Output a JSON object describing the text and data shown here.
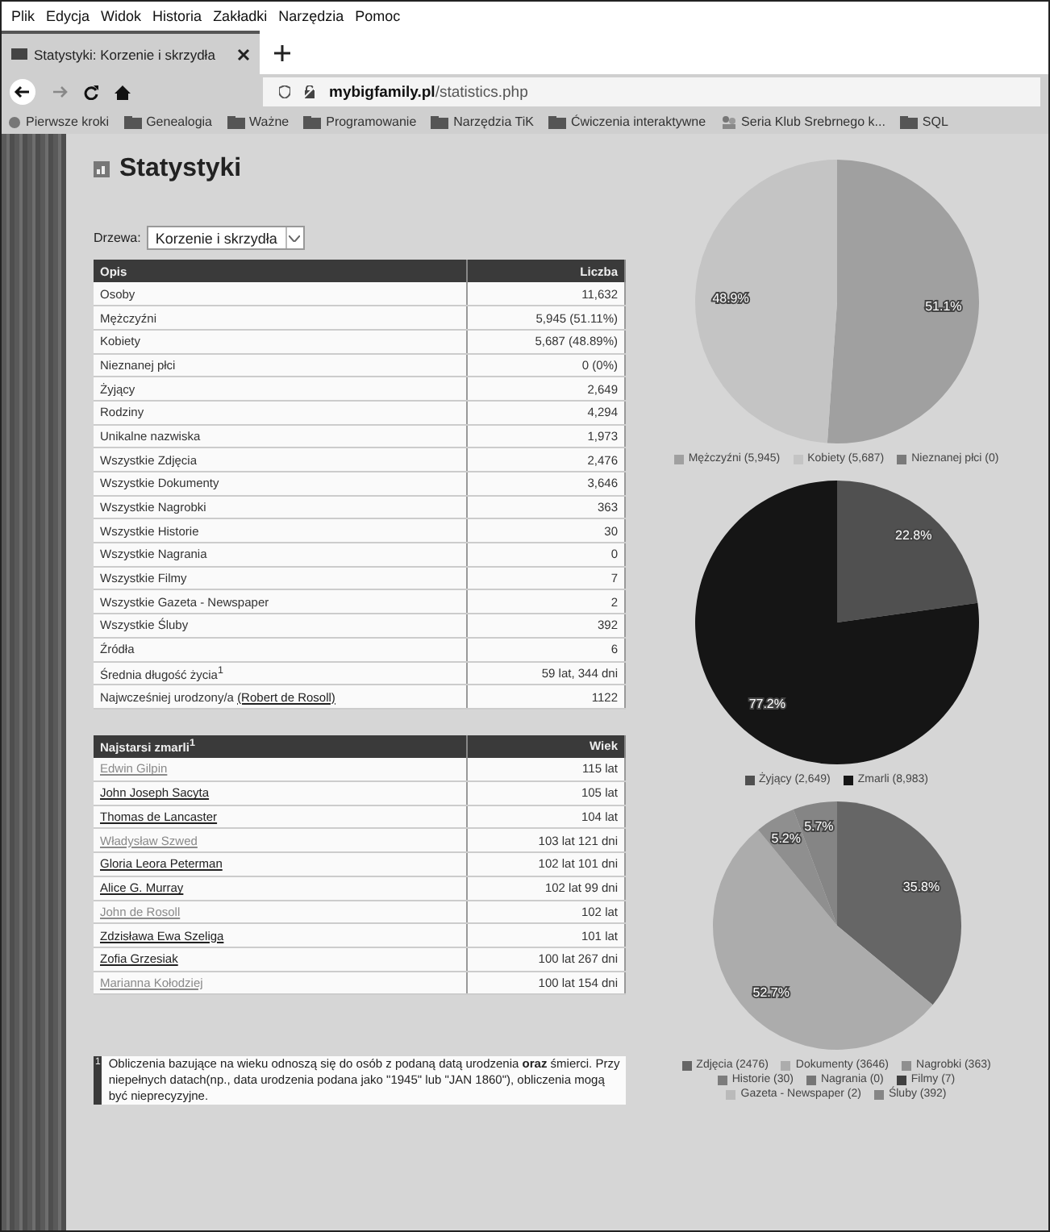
{
  "menu": [
    "Plik",
    "Edycja",
    "Widok",
    "Historia",
    "Zakładki",
    "Narzędzia",
    "Pomoc"
  ],
  "tab": {
    "title": "Statystyki: Korzenie i skrzydła",
    "selected": true
  },
  "address": {
    "domain": "mybigfamily.pl",
    "path": "/statistics.php"
  },
  "bookmarks": [
    {
      "kind": "globe",
      "label": "Pierwsze kroki"
    },
    {
      "kind": "folder",
      "label": "Genealogia"
    },
    {
      "kind": "folder",
      "label": "Ważne"
    },
    {
      "kind": "folder",
      "label": "Programowanie"
    },
    {
      "kind": "folder",
      "label": "Narzędzia TiK"
    },
    {
      "kind": "folder",
      "label": "Ćwiczenia interaktywne"
    },
    {
      "kind": "site",
      "label": "Seria Klub Srebrnego k..."
    },
    {
      "kind": "folder",
      "label": "SQL"
    }
  ],
  "page": {
    "title": "Statystyki",
    "tree_label": "Drzewa:",
    "tree_value": "Korzenie i skrzydła"
  },
  "stats_table": {
    "columns": [
      "Opis",
      "Liczba"
    ],
    "rows": [
      {
        "label": "Osoby",
        "value": "11,632"
      },
      {
        "label": "Mężczyźni",
        "value": "5,945 (51.11%)"
      },
      {
        "label": "Kobiety",
        "value": "5,687 (48.89%)"
      },
      {
        "label": "Nieznanej płci",
        "value": "0 (0%)"
      },
      {
        "label": "Żyjący",
        "value": "2,649"
      },
      {
        "label": "Rodziny",
        "value": "4,294"
      },
      {
        "label": "Unikalne nazwiska",
        "value": "1,973"
      },
      {
        "label": "Wszystkie Zdjęcia",
        "value": "2,476"
      },
      {
        "label": "Wszystkie Dokumenty",
        "value": "3,646"
      },
      {
        "label": "Wszystkie Nagrobki",
        "value": "363"
      },
      {
        "label": "Wszystkie Historie",
        "value": "30"
      },
      {
        "label": "Wszystkie Nagrania",
        "value": "0"
      },
      {
        "label": "Wszystkie Filmy",
        "value": "7"
      },
      {
        "label": "Wszystkie Gazeta - Newspaper",
        "value": "2"
      },
      {
        "label": "Wszystkie Śluby",
        "value": "392"
      },
      {
        "label": "Źródła",
        "value": "6"
      },
      {
        "label": "Średnia długość życia$^{1}$",
        "value": "59 lat, 344 dni"
      },
      {
        "label": "Najwcześniej urodzony/a",
        "link": "(Robert de Rosoll)",
        "value": "1122"
      }
    ]
  },
  "oldest_table": {
    "columns": [
      "Najstarsi zmarli$^{1}$",
      "Wiek"
    ],
    "rows": [
      {
        "name": "Edwin Gilpin",
        "visited": true,
        "age": "115 lat"
      },
      {
        "name": "John Joseph Sacyta",
        "visited": false,
        "age": "105 lat"
      },
      {
        "name": "Thomas de Lancaster",
        "visited": false,
        "age": "104 lat"
      },
      {
        "name": "Władysław Szwed",
        "visited": true,
        "age": "103 lat 121 dni"
      },
      {
        "name": "Gloria Leora Peterman",
        "visited": false,
        "age": "102 lat 101 dni"
      },
      {
        "name": "Alice G. Murray",
        "visited": false,
        "age": "102 lat 99 dni"
      },
      {
        "name": "John de Rosoll",
        "visited": true,
        "age": "102 lat"
      },
      {
        "name": "Zdzisława Ewa Szeliga",
        "visited": false,
        "age": "101 lat"
      },
      {
        "name": "Zofia Grzesiak",
        "visited": false,
        "age": "100 lat 267 dni"
      },
      {
        "name": "Marianna Kołodziej",
        "visited": true,
        "age": "100 lat 154 dni"
      }
    ]
  },
  "footnote": {
    "mark": "1",
    "text": "Obliczenia bazujące na wieku odnoszą się do osób z podaną datą urodzenia **oraz** śmierci. Przy niepełnych datach(np., data urodzenia podana jako \"1945\" lub \"JAN 1860\"), obliczenia mogą być nieprecyzyjne."
  },
  "charts": [
    {
      "chart_data": {
        "type": "pie",
        "legend": "bottom",
        "categories": [
          "Mężczyźni (5,945)",
          "Kobiety (5,687)",
          "Nieznanej płci (0)"
        ],
        "values": [
          51.1,
          48.9,
          0
        ],
        "colors": [
          "#a0a0a0",
          "#c4c4c4",
          "#7a7a7a"
        ],
        "value_labels": [
          "51.1%",
          "48.9%",
          null
        ]
      }
    },
    {
      "chart_data": {
        "type": "pie",
        "legend": "bottom",
        "categories": [
          "Żyjący (2,649)",
          "Zmarli (8,983)"
        ],
        "values": [
          22.8,
          77.2
        ],
        "colors": [
          "#505050",
          "#151515"
        ],
        "value_labels": [
          "22.8%",
          "77.2%"
        ]
      }
    },
    {
      "chart_data": {
        "type": "pie",
        "legend": "bottom",
        "categories": [
          "Zdjęcia (2476)",
          "Dokumenty (3646)",
          "Nagrobki (363)",
          "Historie (30)",
          "Nagrania (0)",
          "Filmy (7)",
          "Gazeta - Newspaper (2)",
          "Śluby (392)"
        ],
        "values": [
          35.8,
          52.7,
          5.2,
          null,
          null,
          null,
          null,
          5.7
        ],
        "colors": [
          "#666666",
          "#acacac",
          "#8f8f8f",
          "#7c7c7c",
          "#757575",
          "#404040",
          "#bababa",
          "#858585"
        ],
        "value_labels": [
          "35.8%",
          "52.7%",
          "5.2%",
          null,
          null,
          null,
          null,
          "5.7%"
        ]
      }
    }
  ]
}
